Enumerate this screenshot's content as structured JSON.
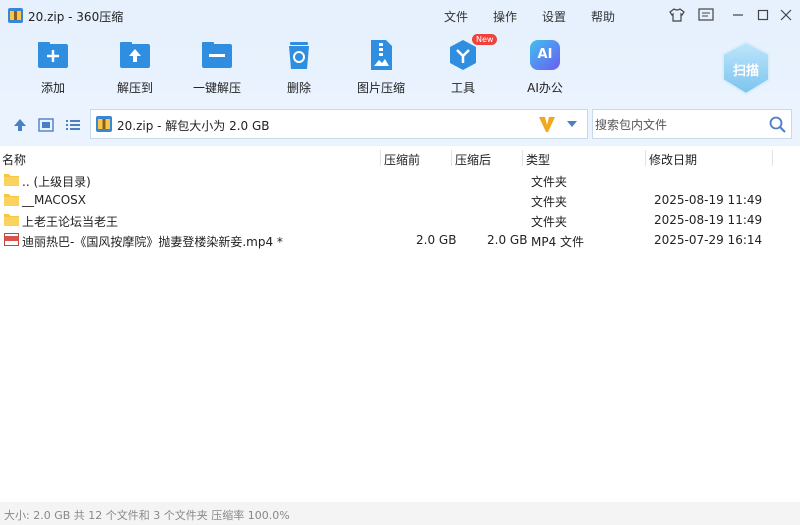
{
  "window": {
    "title": "20.zip - 360压缩",
    "menu": [
      "文件",
      "操作",
      "设置",
      "帮助"
    ]
  },
  "toolbar": {
    "add": "添加",
    "extract_to": "解压到",
    "one_click_extract": "一键解压",
    "delete": "删除",
    "image_compress": "图片压缩",
    "tools": "工具",
    "tools_badge": "New",
    "ai_office": "AI办公",
    "ai_icon_text": "AI",
    "scan": "扫描"
  },
  "address": {
    "path": "20.zip - 解包大小为 2.0 GB"
  },
  "search": {
    "placeholder": "搜索包内文件"
  },
  "columns": {
    "name": "名称",
    "compressed_before": "压缩前",
    "compressed_after": "压缩后",
    "type": "类型",
    "modified": "修改日期"
  },
  "files": [
    {
      "name": ".. (上级目录)",
      "before": "",
      "after": "",
      "type": "文件夹",
      "modified": "",
      "icon": "folder-icon"
    },
    {
      "name": "__MACOSX",
      "before": "",
      "after": "",
      "type": "文件夹",
      "modified": "2025-08-19 11:49",
      "icon": "folder-icon"
    },
    {
      "name": "上老王论坛当老王",
      "before": "",
      "after": "",
      "type": "文件夹",
      "modified": "2025-08-19 11:49",
      "icon": "folder-icon"
    },
    {
      "name": "迪丽热巴-《国风按摩院》抛妻登楼染新妾.mp4 *",
      "before": "2.0 GB",
      "after": "2.0 GB",
      "type": "MP4 文件",
      "modified": "2025-07-29 16:14",
      "icon": "video-file-icon"
    }
  ],
  "status": {
    "text": "大小: 2.0 GB 共 12 个文件和 3 个文件夹 压缩率 100.0%"
  },
  "colors": {
    "accent": "#2f8ee0",
    "toolbar_bg": "#e6f1fd",
    "folder": "#f5c842"
  }
}
